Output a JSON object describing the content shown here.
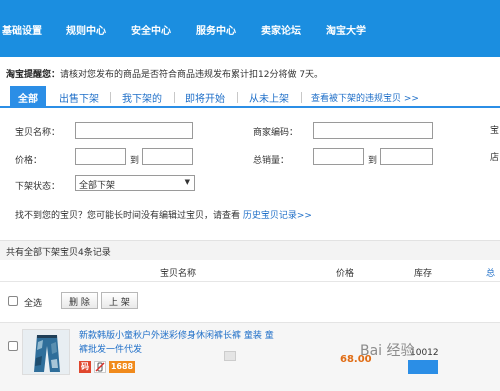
{
  "nav": {
    "items": [
      "基础设置",
      "规则中心",
      "安全中心",
      "服务中心",
      "卖家论坛",
      "淘宝大学"
    ],
    "background": "#1b8ee0"
  },
  "notice": {
    "label": "淘宝提醒您：",
    "text": "请核对您发布的商品是否符合商品违规发布累计扣12分将做 7天。"
  },
  "tabs": {
    "items": [
      "全部",
      "出售下架",
      "我下架的",
      "即将开始",
      "从未上架"
    ],
    "link": "查看被下架的违规宝贝 >>"
  },
  "filters": {
    "name_label": "宝贝名称：",
    "code_label": "商家编码：",
    "price_label": "价格：",
    "price_to": "到",
    "sales_label": "总销量：",
    "sales_to": "到",
    "status_label": "下架状态：",
    "status_value": "全部下架",
    "cut_label_1": "宝",
    "cut_label_2": "店",
    "hint_text": "找不到您的宝贝？您可能长时间没有编辑过宝贝，请查看",
    "hint_link": "历史宝贝记录>>"
  },
  "summary": "共有全部下架宝贝4条记录",
  "table": {
    "headers": [
      "宝贝名称",
      "价格",
      "库存",
      "总"
    ]
  },
  "actions": {
    "select_all": "全选",
    "delete": "删 除",
    "publish": "上 架"
  },
  "row": {
    "title": "新款韩版小童秋户外迷彩修身休闲裤长裤 童装 童裤批发一件代发",
    "badges": [
      "码",
      "",
      "1688"
    ],
    "price": "68.00",
    "stock": "10012"
  },
  "watermark": "Bai 经验"
}
